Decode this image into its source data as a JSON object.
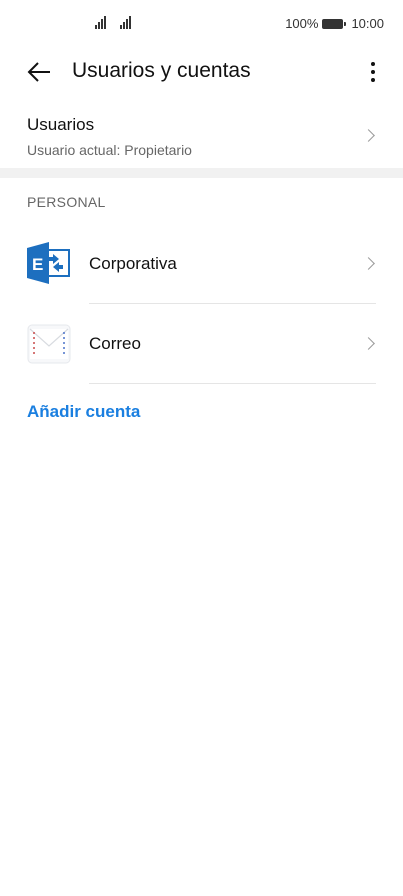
{
  "status_bar": {
    "battery_percent": "100%",
    "time": "10:00"
  },
  "app_bar": {
    "title": "Usuarios y cuentas"
  },
  "users": {
    "title": "Usuarios",
    "subtitle": "Usuario actual: Propietario"
  },
  "section": {
    "header": "PERSONAL"
  },
  "accounts": [
    {
      "label": "Corporativa",
      "icon": "exchange-icon"
    },
    {
      "label": "Correo",
      "icon": "mail-icon"
    }
  ],
  "add_account": {
    "label": "Añadir cuenta"
  },
  "colors": {
    "accent": "#1a7fe0",
    "exchange_blue": "#1d6fbf"
  }
}
